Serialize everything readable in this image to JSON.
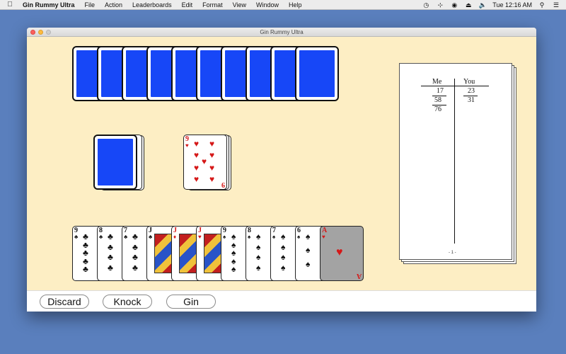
{
  "menubar": {
    "app_name": "Gin Rummy Ultra",
    "items": [
      "File",
      "Action",
      "Leaderboards",
      "Edit",
      "Format",
      "View",
      "Window",
      "Help"
    ],
    "clock": "Tue 12:16 AM"
  },
  "window": {
    "title": "Gin Rummy Ultra"
  },
  "opponent_hand": {
    "count": 10
  },
  "discard_pile": {
    "top_card": {
      "rank": "9",
      "suit": "hearts",
      "color": "red"
    }
  },
  "player_hand": [
    {
      "rank": "9",
      "suit": "clubs"
    },
    {
      "rank": "8",
      "suit": "clubs"
    },
    {
      "rank": "7",
      "suit": "clubs"
    },
    {
      "rank": "J",
      "suit": "clubs"
    },
    {
      "rank": "J",
      "suit": "diamonds"
    },
    {
      "rank": "J",
      "suit": "hearts"
    },
    {
      "rank": "9",
      "suit": "spades"
    },
    {
      "rank": "8",
      "suit": "spades"
    },
    {
      "rank": "7",
      "suit": "spades"
    },
    {
      "rank": "6",
      "suit": "spades"
    },
    {
      "rank": "A",
      "suit": "hearts",
      "highlighted": true
    }
  ],
  "scoresheet": {
    "headers": {
      "me": "Me",
      "you": "You"
    },
    "me": [
      "17",
      "58",
      "76"
    ],
    "you": [
      "23",
      "31"
    ],
    "page": "- 1 -"
  },
  "buttons": {
    "discard": "Discard",
    "knock": "Knock",
    "gin": "Gin"
  },
  "colors": {
    "felt": "#fdeec4",
    "card_back": "#1747f7",
    "red_suit": "#d51818",
    "desktop": "#5a7fbd"
  }
}
